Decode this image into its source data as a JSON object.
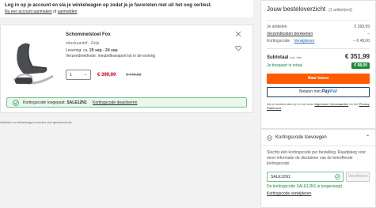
{
  "login": {
    "title": "Log in op je account en sla je winkelwagen op zodat je je favorieten niet uit het oog verliest.",
    "new_customer": "Nu een account aanmaken",
    "or": "of",
    "login_link": "aanmelden"
  },
  "product": {
    "name": "Schommelstoel Fox",
    "variant": "structuurstof - Grijs",
    "delivery_prefix": "Levering: ca.",
    "delivery_dates": "20 sep - 24 sep",
    "method": "Verzendmethode: meubeltransport tot in de woning",
    "quantity": "1",
    "price": "€ 399,99",
    "old_price": "€ 449,99"
  },
  "coupon_bar": {
    "label": "Kortingscode toegepast:",
    "code": "SALE12N1",
    "deactivate": "Kortingscode deactiveren"
  },
  "footnote": "Artikelen in winkelwagen worden niet gereserveerd.",
  "overview": {
    "title": "Jouw besteloverzicht",
    "count": "(1 artikel(en))",
    "rows": [
      {
        "label": "Je artikelen",
        "value": "€ 399,99"
      },
      {
        "label": "Verzendkosten berekenen",
        "value": "–"
      },
      {
        "label": "Kortingscode",
        "link": "Verwijderen",
        "value": "– € 48,00"
      }
    ],
    "subtotal_label": "Subtotaal",
    "subtotal_note": "incl. btw.",
    "subtotal_value": "€ 351,99",
    "saving_label": "Je bespaart in totaal",
    "saving_value": "€ 98,00",
    "checkout": "Naar kassa",
    "paypal_prefix": "Betalen met",
    "paypal_a": "Pay",
    "paypal_b": "Pal",
    "legal_prefix": "Als je besteld stem je in met onze",
    "terms": "Algemene Voorwaarden",
    "legal_mid": "en het",
    "privacy": "Privacy Statement"
  },
  "coupon_panel": {
    "title": "Kortingscode toevoegen",
    "description": "Slechts één kortingscode per bestelling. Raadpleeg voor meer informatie de disclaimer van de betreffende kortingscode.",
    "input_value": "SALE12N1",
    "apply": "Verzilveren",
    "success": "De kortingscode SALE12N1 is toegevoegd.",
    "remove": "Kortingscode verwijderen"
  },
  "colors": {
    "accent": "#ff5a00",
    "success": "#1a8a3a",
    "price": "#d0021b"
  }
}
